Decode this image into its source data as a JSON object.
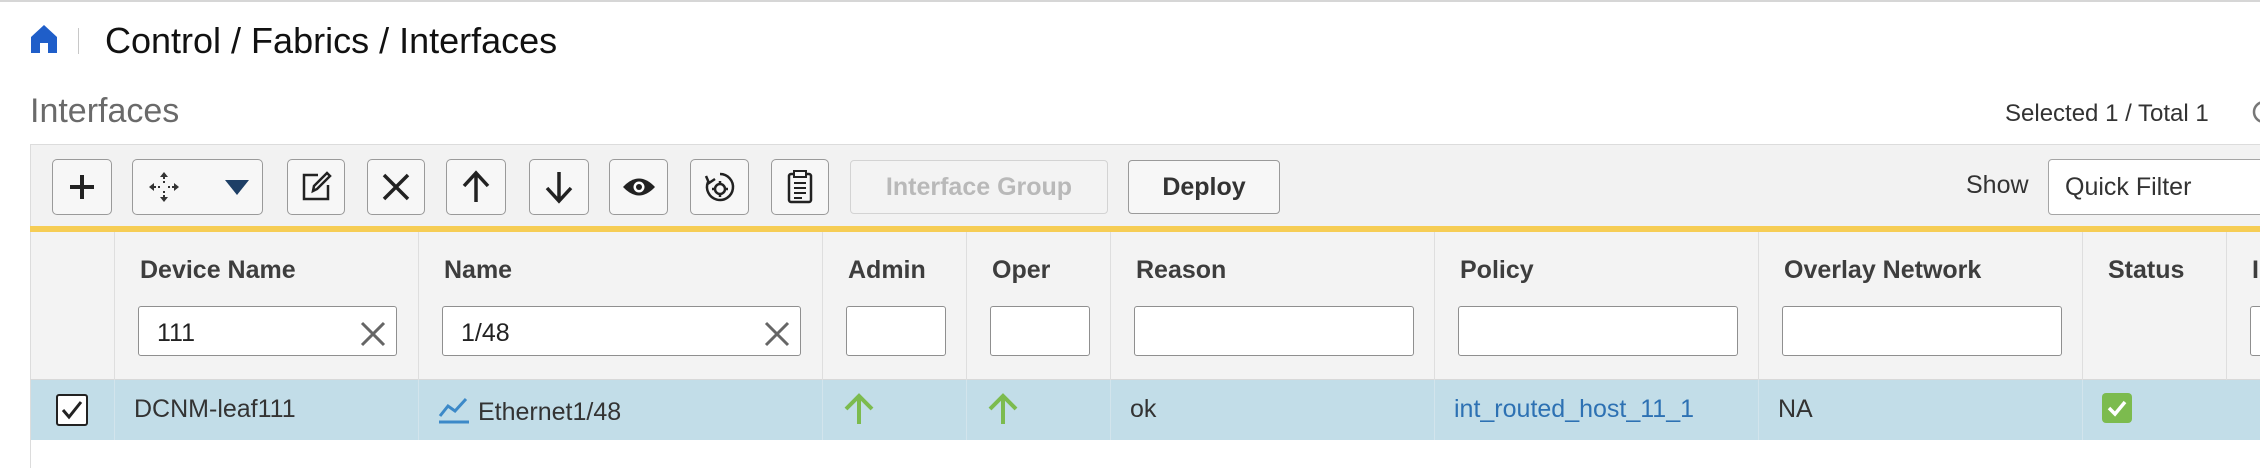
{
  "breadcrumb": {
    "path": "Control / Fabrics / Interfaces"
  },
  "page": {
    "title": "Interfaces",
    "selection_summary": "Selected 1 / Total 1"
  },
  "toolbar": {
    "icons": [
      "plus-icon",
      "move-icon",
      "edit-icon",
      "delete-icon",
      "no-shutdown-icon",
      "shutdown-icon",
      "show-icon",
      "rediscover-icon",
      "history-icon"
    ],
    "interface_group_label": "Interface Group",
    "deploy_label": "Deploy",
    "show_label": "Show",
    "show_value": "Quick Filter"
  },
  "table": {
    "columns": [
      "Device Name",
      "Name",
      "Admin",
      "Oper",
      "Reason",
      "Policy",
      "Overlay Network",
      "Status",
      "I"
    ],
    "filters": {
      "device_name": "111",
      "name": "1/48",
      "admin": "",
      "oper": "",
      "reason": "",
      "policy": "",
      "overlay_network": ""
    },
    "rows": [
      {
        "selected": true,
        "device_name": "DCNM-leaf111",
        "name": "Ethernet1/48",
        "admin": "up",
        "oper": "up",
        "reason": "ok",
        "policy": "int_routed_host_11_1",
        "overlay_network": "NA",
        "status": "ok"
      }
    ]
  },
  "colors": {
    "accent_bar": "#f6cd55",
    "selected_row": "#c2dde8",
    "link": "#2d71b3",
    "status_up": "#7cbb4e",
    "home_icon": "#1f5ec9"
  }
}
